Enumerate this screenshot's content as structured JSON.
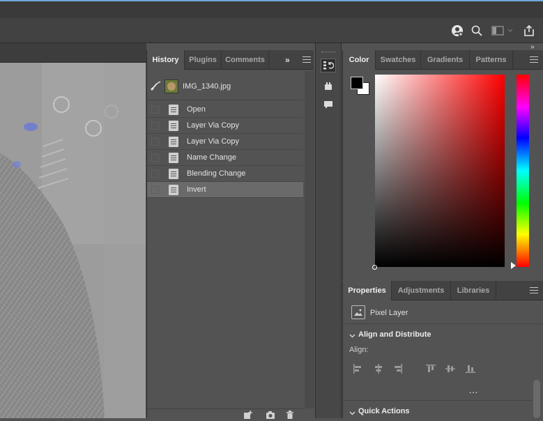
{
  "history": {
    "tabs": [
      {
        "label": "History",
        "active": true
      },
      {
        "label": "Plugins",
        "active": false
      },
      {
        "label": "Comments",
        "active": false
      }
    ],
    "snapshot_name": "IMG_1340.jpg",
    "states": [
      {
        "label": "Open",
        "selected": false
      },
      {
        "label": "Layer Via Copy",
        "selected": false
      },
      {
        "label": "Layer Via Copy",
        "selected": false
      },
      {
        "label": "Name Change",
        "selected": false
      },
      {
        "label": "Blending Change",
        "selected": false
      },
      {
        "label": "Invert",
        "selected": true
      }
    ]
  },
  "color_panel": {
    "tabs": [
      {
        "label": "Color",
        "active": true
      },
      {
        "label": "Swatches",
        "active": false
      },
      {
        "label": "Gradients",
        "active": false
      },
      {
        "label": "Patterns",
        "active": false
      }
    ],
    "foreground": "#000000",
    "background": "#ffffff",
    "hue_base": "#ff0000"
  },
  "properties_panel": {
    "tabs": [
      {
        "label": "Properties",
        "active": true
      },
      {
        "label": "Adjustments",
        "active": false
      },
      {
        "label": "Libraries",
        "active": false
      }
    ],
    "layer_type": "Pixel Layer",
    "sections": {
      "align": "Align and Distribute",
      "align_label": "Align:",
      "quick_actions": "Quick Actions"
    }
  },
  "icons": {
    "topbar": [
      "user-add-icon",
      "search-icon",
      "workspace-icon",
      "share-icon"
    ],
    "strip": [
      "history-icon",
      "plugins-icon",
      "comments-icon"
    ],
    "history_footer": [
      "new-document-icon",
      "camera-icon",
      "trash-icon"
    ]
  }
}
